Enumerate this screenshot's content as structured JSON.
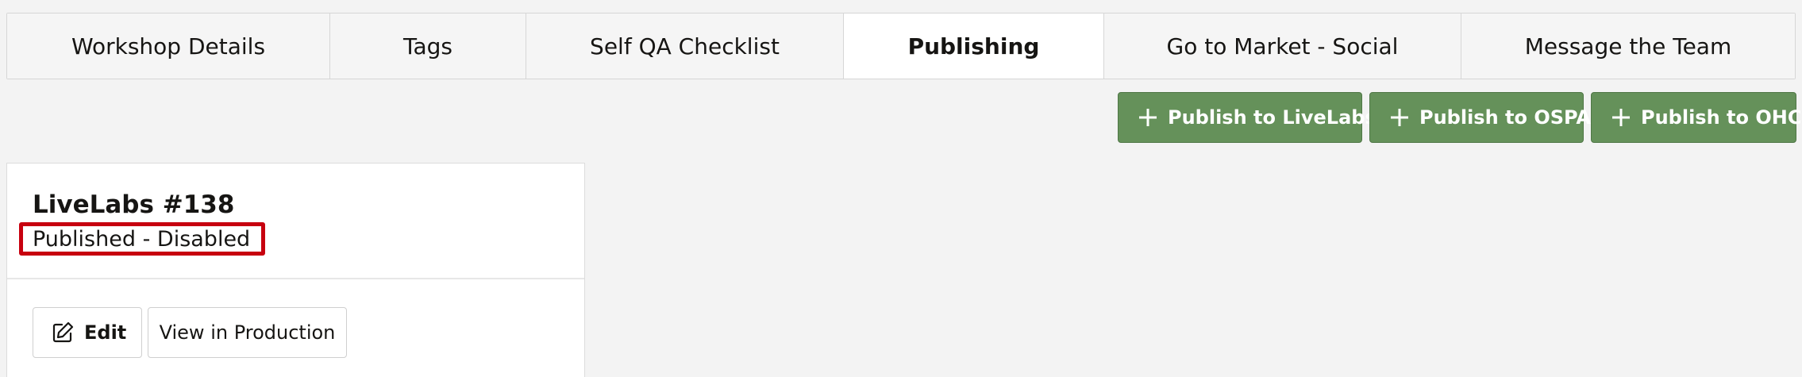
{
  "tabs": [
    {
      "label": "Workshop Details",
      "active": false
    },
    {
      "label": "Tags",
      "active": false
    },
    {
      "label": "Self QA Checklist",
      "active": false
    },
    {
      "label": "Publishing",
      "active": true
    },
    {
      "label": "Go to Market - Social",
      "active": false
    },
    {
      "label": "Message the Team",
      "active": false
    }
  ],
  "actions": {
    "publish_livelabs": "Publish to LiveLabs",
    "publish_ospa": "Publish to OSPA",
    "publish_ohc": "Publish to OHC",
    "icon": "plus-icon"
  },
  "card": {
    "title": "LiveLabs #138",
    "status": "Published - Disabled",
    "edit_label": "Edit",
    "edit_icon": "pencil-icon",
    "view_label": "View in Production"
  },
  "colors": {
    "accent_green": "#65915a",
    "highlight_red": "#c7000f",
    "background": "#f3f3f3"
  }
}
